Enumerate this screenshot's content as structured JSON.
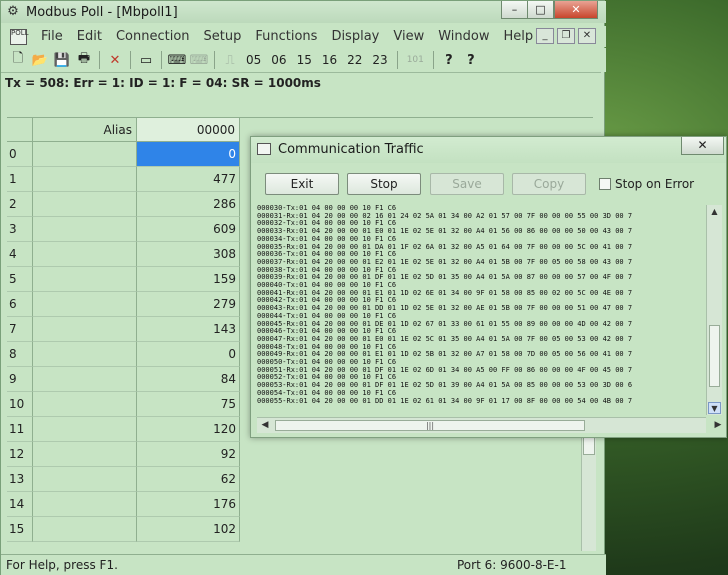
{
  "window": {
    "title": "Modbus Poll - [Mbpoll1]",
    "minimize": "–",
    "maximize": "□",
    "close": "✕"
  },
  "menu": {
    "doc_icon_text": "POLL",
    "items": [
      "File",
      "Edit",
      "Connection",
      "Setup",
      "Functions",
      "Display",
      "View",
      "Window",
      "Help"
    ]
  },
  "mdi": {
    "minimize": "_",
    "restore": "❐",
    "close": "✕"
  },
  "toolbar": {
    "new": "🗋",
    "open": "📂",
    "save": "💾",
    "print": "🖶",
    "delete": "✕",
    "window": "▭",
    "connect": "⌨",
    "disconnect": "⌨",
    "pulse": "⎍",
    "func_codes": [
      "05",
      "06",
      "15",
      "16",
      "22",
      "23"
    ],
    "disabled_code": "101",
    "help": "?",
    "context_help": "?"
  },
  "status_line": "Tx = 508: Err = 1: ID = 1: F = 04: SR = 1000ms",
  "grid": {
    "alias_header": "Alias",
    "register_header": "00000",
    "rows": [
      {
        "n": "0",
        "v": "0"
      },
      {
        "n": "1",
        "v": "477"
      },
      {
        "n": "2",
        "v": "286"
      },
      {
        "n": "3",
        "v": "609"
      },
      {
        "n": "4",
        "v": "308"
      },
      {
        "n": "5",
        "v": "159"
      },
      {
        "n": "6",
        "v": "279"
      },
      {
        "n": "7",
        "v": "143"
      },
      {
        "n": "8",
        "v": "0"
      },
      {
        "n": "9",
        "v": "84"
      },
      {
        "n": "10",
        "v": "75"
      },
      {
        "n": "11",
        "v": "120"
      },
      {
        "n": "12",
        "v": "92"
      },
      {
        "n": "13",
        "v": "62"
      },
      {
        "n": "14",
        "v": "176"
      },
      {
        "n": "15",
        "v": "102"
      }
    ]
  },
  "statusbar": {
    "help": "For Help, press F1.",
    "port": "Port 6: 9600-8-E-1"
  },
  "traffic": {
    "title": "Communication Traffic",
    "close": "✕",
    "buttons": {
      "exit": "Exit",
      "stop": "Stop",
      "save": "Save",
      "copy": "Copy"
    },
    "stop_on_error": "Stop on Error",
    "log": [
      "000030-Tx:01 04 00 00 00 10 F1 C6",
      "000031-Rx:01 04 20 00 00 02 16 01 24 02 5A 01 34 00 A2 01 57 00 7F 00 00 00 55 00 3D 00 7",
      "000032-Tx:01 04 00 00 00 10 F1 C6",
      "000033-Rx:01 04 20 00 00 01 E0 01 1E 02 5E 01 32 00 A4 01 56 00 86 00 00 00 50 00 43 00 7",
      "000034-Tx:01 04 00 00 00 10 F1 C6",
      "000035-Rx:01 04 20 00 00 01 DA 01 1F 02 6A 01 32 00 A5 01 64 00 7F 00 00 00 5C 00 41 00 7",
      "000036-Tx:01 04 00 00 00 10 F1 C6",
      "000037-Rx:01 04 20 00 00 01 E2 01 1E 02 5E 01 32 00 A4 01 5B 00 7F 00 05 00 58 00 43 00 7",
      "000038-Tx:01 04 00 00 00 10 F1 C6",
      "000039-Rx:01 04 20 00 00 01 DF 01 1E 02 5D 01 35 00 A4 01 5A 00 87 00 00 00 57 00 4F 00 7",
      "000040-Tx:01 04 00 00 00 10 F1 C6",
      "000041-Rx:01 04 20 00 00 01 E1 01 1D 02 6E 01 34 00 9F 01 58 00 85 00 02 00 5C 00 4E 00 7",
      "000042-Tx:01 04 00 00 00 10 F1 C6",
      "000043-Rx:01 04 20 00 00 01 DD 01 1D 02 5E 01 32 00 AE 01 5B 00 7F 00 00 00 51 00 47 00 7",
      "000044-Tx:01 04 00 00 00 10 F1 C6",
      "000045-Rx:01 04 20 00 00 01 DE 01 1D 02 67 01 33 00 61 01 55 00 89 00 00 00 4D 00 42 00 7",
      "000046-Tx:01 04 00 00 00 10 F1 C6",
      "000047-Rx:01 04 20 00 00 01 E0 01 1E 02 5C 01 35 00 A4 01 5A 00 7F 00 05 00 53 00 42 00 7",
      "000048-Tx:01 04 00 00 00 10 F1 C6",
      "000049-Rx:01 04 20 00 00 01 E1 01 1D 02 5B 01 32 00 A7 01 58 00 7D 00 05 00 56 00 41 00 7",
      "000050-Tx:01 04 00 00 00 10 F1 C6",
      "000051-Rx:01 04 20 00 00 01 DF 01 1E 02 6D 01 34 00 A5 00 FF 00 86 00 00 00 4F 00 45 00 7",
      "000052-Tx:01 04 00 00 00 10 F1 C6",
      "000053-Rx:01 04 20 00 00 01 DF 01 1E 02 5D 01 39 00 A4 01 5A 00 85 00 00 00 53 00 3D 00 6",
      "000054-Tx:01 04 00 00 00 10 F1 C6",
      "000055-Rx:01 04 20 00 00 01 DD 01 1E 02 61 01 34 00 9F 01 17 00 8F 00 00 00 54 00 4B 00 7"
    ],
    "scroll_up": "▲",
    "scroll_down": "▼",
    "scroll_left": "◀",
    "scroll_right": "▶",
    "thumb_grip": "|||"
  }
}
